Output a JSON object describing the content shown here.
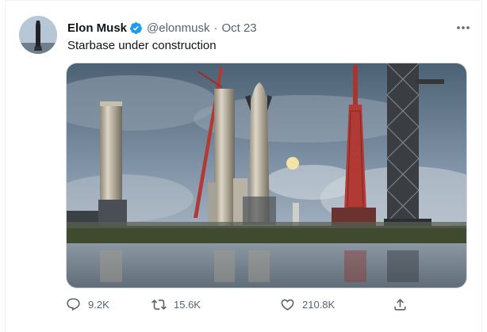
{
  "tweet": {
    "author_name": "Elon Musk",
    "author_handle": "@elonmusk",
    "separator": "·",
    "date": "Oct 23",
    "text": "Starbase under construction",
    "verified": true
  },
  "actions": {
    "reply_count": "9.2K",
    "retweet_count": "15.6K",
    "like_count": "210.8K"
  },
  "icons": [
    "avatar",
    "verified-badge-icon",
    "more-options-icon",
    "reply-icon",
    "retweet-icon",
    "like-icon",
    "share-icon"
  ],
  "colors": {
    "verified_blue": "#1d9bf0",
    "secondary_text": "#536471",
    "primary_text": "#0f1419"
  }
}
